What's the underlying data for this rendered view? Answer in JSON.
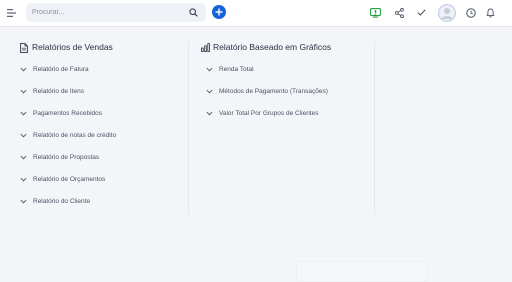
{
  "header": {
    "search_placeholder": "Procurar...",
    "icons": {
      "menu": "menu-icon",
      "search": "search-icon",
      "add": "plus-icon",
      "screen": "screen-icon",
      "share": "share-icon",
      "check": "check-icon",
      "avatar": "avatar-icon",
      "clock": "clock-icon",
      "bell": "bell-icon"
    },
    "colors": {
      "accent": "#1565d8",
      "screen_green": "#22a447"
    }
  },
  "sales_reports": {
    "title": "Relatórios de Vendas",
    "items": [
      "Relatório de Fatura",
      "Relatório de Itens",
      "Pagamentos Recebidos",
      "Relatório de notas de crédito",
      "Relatório de Propostas",
      "Relatório de Orçamentos",
      "Relatório do Cliente"
    ]
  },
  "chart_reports": {
    "title": "Relatório Baseado em Gráficos",
    "items": [
      "Renda Total",
      "Métodos de Pagamento (Transações)",
      "Valor Total Por Grupos de Clientes"
    ]
  }
}
